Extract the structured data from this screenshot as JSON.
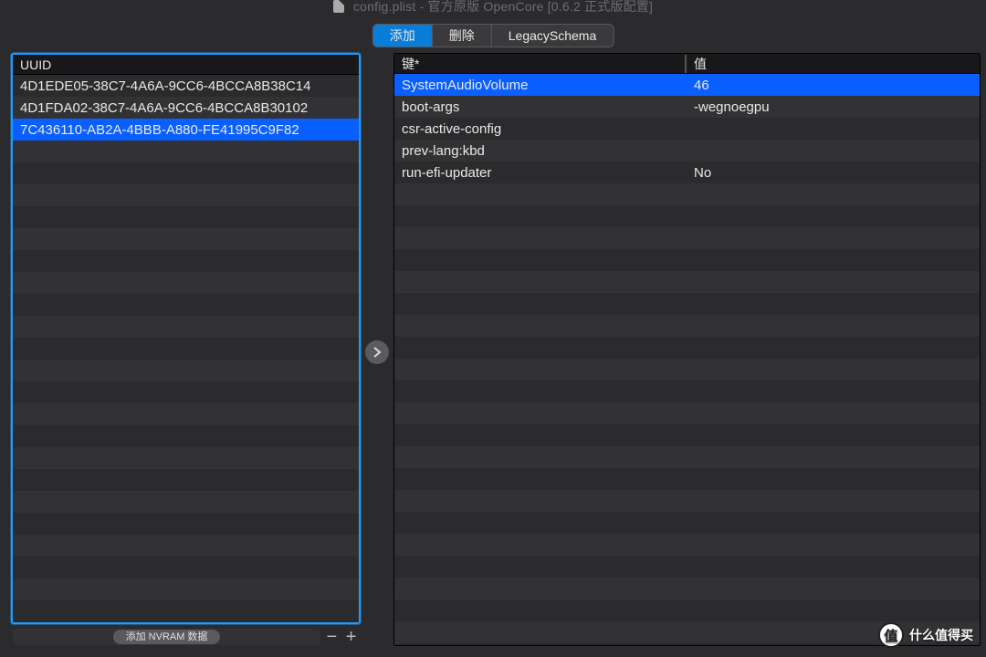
{
  "title": {
    "filename": "config.plist",
    "subtitle": "官方原版 OpenCore [0.6.2 正式版配置]"
  },
  "tabs": {
    "items": [
      "添加",
      "删除",
      "LegacySchema"
    ],
    "active_index": 0
  },
  "left": {
    "header": "UUID",
    "rows": [
      "4D1EDE05-38C7-4A6A-9CC6-4BCCA8B38C14",
      "4D1FDA02-38C7-4A6A-9CC6-4BCCA8B30102",
      "7C436110-AB2A-4BBB-A880-FE41995C9F82"
    ],
    "selected_index": 2,
    "footer_button": "添加 NVRAM 数据"
  },
  "right": {
    "headers": {
      "key": "键*",
      "value": "值"
    },
    "rows": [
      {
        "key": "SystemAudioVolume",
        "value": "46"
      },
      {
        "key": "boot-args",
        "value": "-wegnoegpu"
      },
      {
        "key": "csr-active-config",
        "value": ""
      },
      {
        "key": "prev-lang:kbd",
        "value": ""
      },
      {
        "key": "run-efi-updater",
        "value": "No"
      }
    ],
    "selected_index": 0
  },
  "watermark": "什么值得买"
}
